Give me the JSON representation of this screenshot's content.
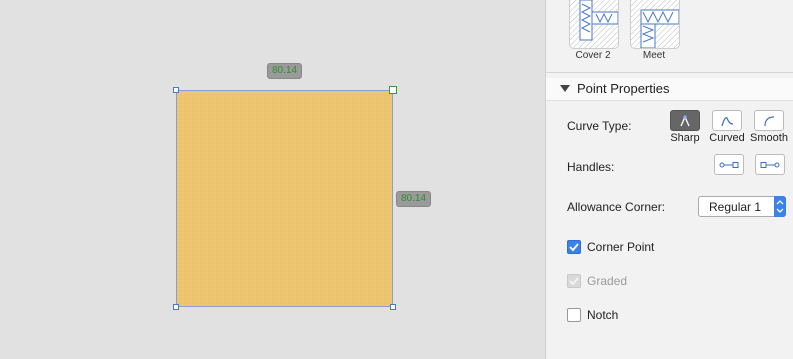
{
  "canvas": {
    "dim_top": "80.14",
    "dim_right": "80.14",
    "piece_color": "#edc46e"
  },
  "thumbnails": [
    {
      "label": "Cover 2"
    },
    {
      "label": "Meet"
    }
  ],
  "point_properties": {
    "title": "Point Properties",
    "curve_type_label": "Curve Type:",
    "curve_types": [
      "Sharp",
      "Curved",
      "Smooth"
    ],
    "curve_type_selected": "Sharp",
    "handles_label": "Handles:",
    "allowance_corner_label": "Allowance Corner:",
    "allowance_corner_value": "Regular 1",
    "corner_point_label": "Corner Point",
    "corner_point_checked": true,
    "graded_label": "Graded",
    "graded_checked": true,
    "graded_disabled": true,
    "notch_label": "Notch",
    "notch_checked": false
  },
  "colors": {
    "accent": "#3b82e8",
    "dimension_text": "#2f8f2f"
  }
}
